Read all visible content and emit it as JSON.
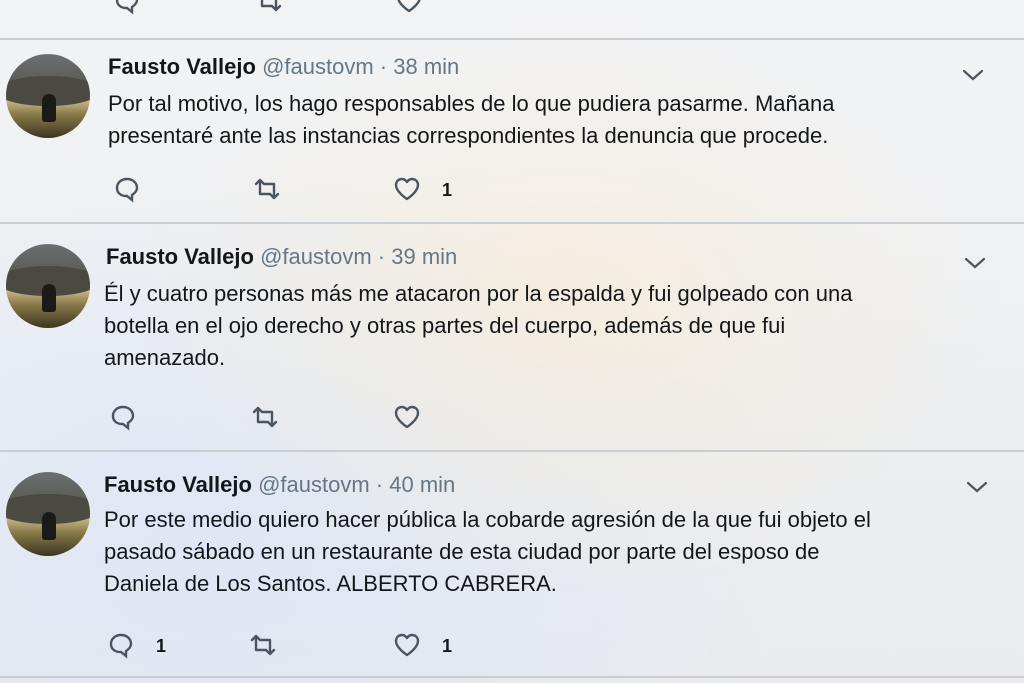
{
  "tweets": [
    {
      "name": "Fausto Vallejo",
      "handle": "@faustovm",
      "separator": "·",
      "time": "38 min",
      "lines": [
        "Por tal motivo, los hago responsables de lo que pudiera pasarme. Mañana",
        "presentaré ante las instancias correspondientes la denuncia que procede."
      ],
      "reply_count": "",
      "like_count": "1"
    },
    {
      "name": "Fausto Vallejo",
      "handle": "@faustovm",
      "separator": "·",
      "time": "39 min",
      "lines": [
        "Él y cuatro personas más me atacaron por la espalda y fui golpeado con una",
        "botella en el ojo derecho y otras partes del cuerpo, además de que fui",
        "amenazado."
      ],
      "reply_count": "",
      "like_count": ""
    },
    {
      "name": "Fausto Vallejo",
      "handle": "@faustovm",
      "separator": "·",
      "time": "40 min",
      "lines": [
        "Por este medio quiero hacer pública la cobarde agresión de la que fui objeto el",
        "pasado sábado en un restaurante de esta ciudad por parte del esposo de",
        "Daniela de Los Santos. ALBERTO CABRERA."
      ],
      "reply_count": "1",
      "like_count": "1"
    }
  ],
  "icons": {
    "reply": "reply-icon",
    "retweet": "retweet-icon",
    "like": "heart-icon",
    "menu": "chevron-down-icon",
    "avatar": "avatar"
  },
  "colors": {
    "name": "#14171a",
    "meta": "#657786",
    "icon": "#4a5560",
    "divider": "#c9ced3"
  }
}
